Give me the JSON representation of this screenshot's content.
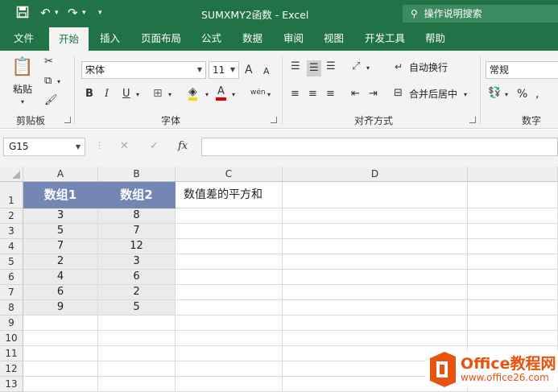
{
  "window": {
    "title": "SUMXMY2函数  -  Excel",
    "tell_me": "操作说明搜索"
  },
  "tabs": [
    "文件",
    "开始",
    "插入",
    "页面布局",
    "公式",
    "数据",
    "审阅",
    "视图",
    "开发工具",
    "帮助"
  ],
  "ribbon": {
    "clipboard": {
      "paste": "粘贴",
      "label": "剪贴板"
    },
    "font": {
      "name": "宋体",
      "size": "11",
      "grow": "A",
      "shrink": "A",
      "bold": "B",
      "italic": "I",
      "underline": "U",
      "font_color": "A",
      "phonetic": "wén",
      "label": "字体"
    },
    "alignment": {
      "wrap": "自动换行",
      "merge": "合并后居中",
      "label": "对齐方式"
    },
    "number": {
      "format": "常规",
      "percent": "%",
      "label": "数字"
    }
  },
  "formula_bar": {
    "name_box": "G15",
    "fx": "fx",
    "formula": ""
  },
  "sheet": {
    "columns": [
      "A",
      "B",
      "C",
      "D"
    ],
    "rows": [
      "1",
      "2",
      "3",
      "4",
      "5",
      "6",
      "7",
      "8",
      "9",
      "10",
      "11",
      "12",
      "13"
    ],
    "header_a": "数组1",
    "header_b": "数组2",
    "c1": "数值差的平方和",
    "array1": [
      "3",
      "5",
      "7",
      "2",
      "4",
      "6",
      "9"
    ],
    "array2": [
      "8",
      "7",
      "12",
      "3",
      "6",
      "2",
      "5"
    ],
    "header_fill": "#7386B6",
    "data_fill": "#EBEBEB"
  },
  "watermark": {
    "brand": "Office教程网",
    "url": "www.office26.com",
    "accent": "#E8540F"
  }
}
